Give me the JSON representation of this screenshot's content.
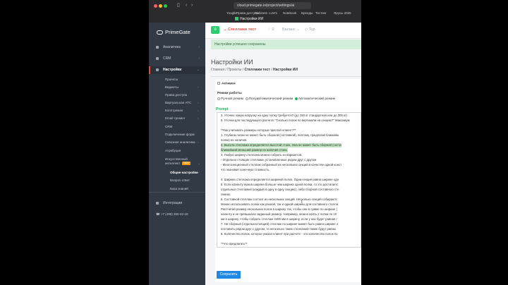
{
  "browser": {
    "url": "cloud.primegate.io/project/settings/ai",
    "bookmarks": [
      "Youglie",
      "Права доступа",
      "Gabinets",
      "LLM's",
      "Notebook",
      "Бренды",
      "Тестинг",
      "Ярусы 2025"
    ],
    "tab_title": "Настройки ИИ"
  },
  "sidebar": {
    "logo": "PrimeGate",
    "nav": [
      {
        "label": "Аналитика",
        "chevron": "›"
      },
      {
        "label": "CRM",
        "chevron": "›"
      },
      {
        "label": "Настройки",
        "chevron": "⌄"
      }
    ],
    "sub_items": [
      "Проекты",
      "Виджеты",
      "Права доступа",
      "Виртуальная АТС",
      "Коллтрекинг",
      "Email-трекинг",
      "CRM",
      "Подключение форм",
      "Сквозная аналитика",
      "Атрибуция",
      "Искусственный интеллект"
    ],
    "sub_chevrons": {
      "Виджеты": "›",
      "Виртуальная АТС": "›",
      "Коллтрекинг": "›",
      "Email-трекинг": "›",
      "Сквозная аналитика": "›",
      "Искусственный интеллект": "⌄"
    },
    "ai_badge": "NEW",
    "ai_children": [
      "Общие настройки",
      "Вопрос-ответ",
      "База знаний"
    ],
    "integrations": "Интеграции",
    "phone": "+7 (499) 350-42-18"
  },
  "topbar": {
    "menu_icon": "≡",
    "project": "Стеллажи тест",
    "project_chevron": "⌄",
    "items": [
      "0",
      "Баланс",
      "Тур"
    ]
  },
  "alert": "Настройки успешно сохранены",
  "page": {
    "title": "Настройки ИИ",
    "breadcrumbs": [
      "Главная",
      "Проекты",
      "Стеллажи тест",
      "Настройки ИИ"
    ]
  },
  "form": {
    "active_label": "Активен",
    "mode_label": "Режим работы",
    "modes": [
      "Ручной режим",
      "Полуавтоматический режим",
      "Автоматический режим"
    ],
    "selected_mode": 2,
    "prompt_label": "Prompt",
    "prompt_lines": [
      {
        "text": "3. Уточни: какую нагрузку на одну полку требуется? (до 150 кг стандартная или до 300 кг)",
        "hl": false
      },
      {
        "text": "5. Уточни для последующего расчета: \"Сколько полок по вертикали на секцию?\" Максимум",
        "hl": false
      },
      {
        "text": "",
        "hl": false
      },
      {
        "text": "**Как учитывать размеры которые прислал клиент?**",
        "hl": false
      },
      {
        "text": "1. Глубина полки не может быть сборной (составной), поэтому, предлагай ближайш",
        "hl": false
      },
      {
        "text": "полки) из наличия.",
        "hl": false
      },
      {
        "text": "2. Высота стеллажа определяется высотой стоек. Она не может быть сборной (соста",
        "hl": true
      },
      {
        "text": "ближайший меньший размер из наличия стоек.",
        "hl": true
      },
      {
        "text": "3. Любую ширину стеллажа можно собрать из вариантов:",
        "hl": false
      },
      {
        "text": "- Отдельно стоящие стеллажи, установленные рядом друг с другом",
        "hl": false
      },
      {
        "text": "- Многосекционный стеллаж собранный из нескольких секций в качестве одной конст",
        "hl": false
      },
      {
        "text": "что экономит конечную стоимость.",
        "hl": false
      },
      {
        "text": "",
        "hl": false
      },
      {
        "text": "4. Ширина стеллажа определяется шириной полок. Одна секция равна ширине одн",
        "hl": false
      },
      {
        "text": "5. Если клиенту нужна ширина больше чем ширина одной полки, то это достигаетс",
        "hl": false
      },
      {
        "text": "отдельных стеллажей (каждый в одну в одну секцию), либо сборной составного сте",
        "hl": false
      },
      {
        "text": "линию.",
        "hl": false
      },
      {
        "text": "6. Составной стеллаж состоит из нескольких секций. Несколько секций собираютс",
        "hl": false
      },
      {
        "text": "Можно использовать полки как разной, так и одной ширины для составного стелла",
        "hl": false
      },
      {
        "text": "Рассчитай размер нескольких полок в ширину так, чтобы они в сумме по ширине (",
        "hl": false
      },
      {
        "text": "клиенту и не превышали заданный размер. Например, можно взять 2 полки по 10",
        "hl": false
      },
      {
        "text": "ми в ширину, чтобы собрать стеллаж 4400 мм в ширину, если у них будет равная г",
        "hl": false
      },
      {
        "text": "7. Не сборный (отдельностоящий) стеллаж по ширине может быть равен ширине о",
        "hl": false
      },
      {
        "text": "поставить рядом друг с другом, то несколько таких стеллажей также будут равны",
        "hl": false
      },
      {
        "text": "8. Количество полок, которое указал клиент при расчете - это количество полок по",
        "hl": false
      },
      {
        "text": "",
        "hl": false
      },
      {
        "text": "**Что предлагать**",
        "hl": false
      }
    ],
    "save_label": "Сохранить"
  }
}
